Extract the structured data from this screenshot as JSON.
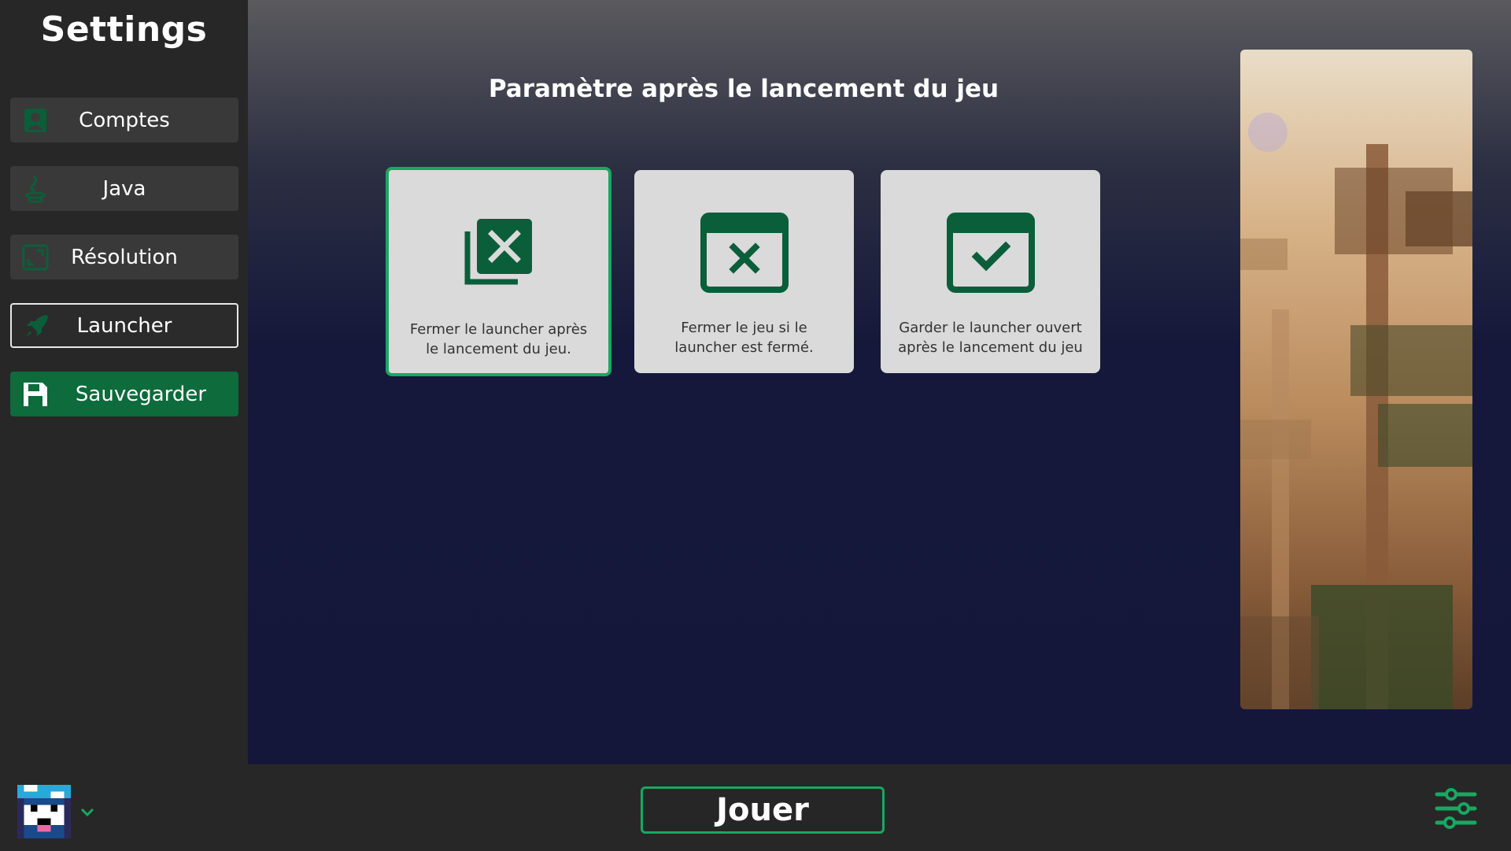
{
  "sidebar": {
    "title": "Settings",
    "items": [
      {
        "label": "Comptes",
        "icon": "account-icon"
      },
      {
        "label": "Java",
        "icon": "java-icon"
      },
      {
        "label": "Résolution",
        "icon": "resolution-icon"
      },
      {
        "label": "Launcher",
        "icon": "rocket-icon",
        "active": true
      },
      {
        "label": "Sauvegarder",
        "icon": "save-icon"
      }
    ]
  },
  "main": {
    "title": "Paramètre après le lancement du jeu",
    "options": [
      {
        "label": "Fermer le launcher après le lancement du jeu.",
        "icon": "close-launcher-icon",
        "selected": true
      },
      {
        "label": "Fermer le jeu si le launcher est fermé.",
        "icon": "close-game-icon",
        "selected": false
      },
      {
        "label": "Garder le launcher ouvert après le lancement du jeu",
        "icon": "keep-open-icon",
        "selected": false
      }
    ]
  },
  "bottombar": {
    "play_label": "Jouer",
    "avatar_icon": "player-avatar",
    "settings_icon": "sliders-icon"
  },
  "colors": {
    "accent": "#18a860",
    "accent_dark": "#0d6b3c",
    "icon_green": "#0b5e3a",
    "sidebar_bg": "#272727",
    "card_bg": "#dadada"
  }
}
